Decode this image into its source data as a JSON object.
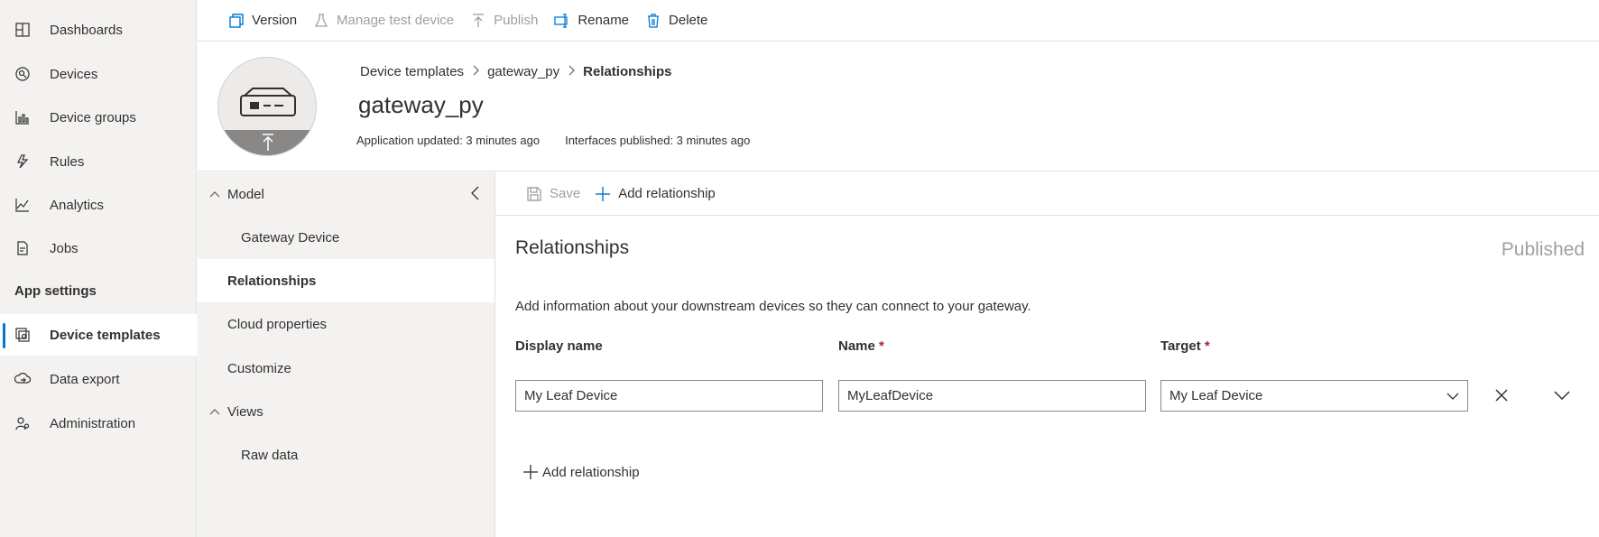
{
  "nav": {
    "items": [
      {
        "label": "Dashboards",
        "icon": "dashboard-icon"
      },
      {
        "label": "Devices",
        "icon": "devices-icon"
      },
      {
        "label": "Device groups",
        "icon": "device-groups-icon"
      },
      {
        "label": "Rules",
        "icon": "rules-icon"
      },
      {
        "label": "Analytics",
        "icon": "analytics-icon"
      },
      {
        "label": "Jobs",
        "icon": "jobs-icon"
      }
    ],
    "section_label": "App settings",
    "settings_items": [
      {
        "label": "Device templates",
        "icon": "device-templates-icon",
        "active": true
      },
      {
        "label": "Data export",
        "icon": "data-export-icon"
      },
      {
        "label": "Administration",
        "icon": "administration-icon"
      }
    ]
  },
  "toolbar": {
    "version": "Version",
    "manage_test_device": "Manage test device",
    "publish": "Publish",
    "rename": "Rename",
    "delete": "Delete"
  },
  "header": {
    "breadcrumb": [
      "Device templates",
      "gateway_py",
      "Relationships"
    ],
    "title": "gateway_py",
    "app_updated": "Application updated: 3 minutes ago",
    "interfaces_published": "Interfaces published: 3 minutes ago"
  },
  "subnav": {
    "model_label": "Model",
    "gateway_device": "Gateway Device",
    "relationships": "Relationships",
    "cloud_properties": "Cloud properties",
    "customize": "Customize",
    "views_label": "Views",
    "raw_data": "Raw data"
  },
  "main": {
    "save_label": "Save",
    "add_relationship_label": "Add relationship",
    "section_title": "Relationships",
    "status": "Published",
    "description": "Add information about your downstream devices so they can connect to your gateway.",
    "columns": {
      "display_name": "Display name",
      "name": "Name",
      "target": "Target",
      "required_marker": "*"
    },
    "row": {
      "display_name": "My Leaf Device",
      "name": "MyLeafDevice",
      "target": "My Leaf Device"
    },
    "add_relationship_bottom": "Add relationship"
  },
  "colors": {
    "accent": "#0078d4",
    "nav_bg": "#f3f2f1",
    "disabled": "#a19f9d",
    "required": "#a4262c"
  }
}
